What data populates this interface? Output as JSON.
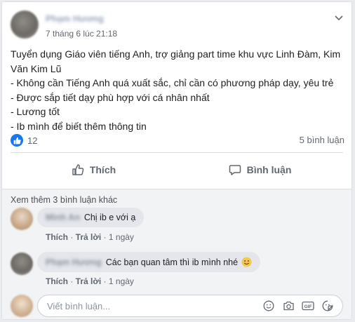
{
  "post": {
    "author": "Phạm Hương",
    "time": "7 tháng 6 lúc 21:18",
    "lines": [
      "Tuyển dụng Giáo viên tiếng Anh, trợ giảng part time khu vực Linh Đàm, Kim Văn Kim Lũ",
      "- Không cần Tiếng Anh quá xuất sắc, chỉ cần có phương pháp dạy, yêu trẻ",
      "- Được sắp tiết dạy phù hợp với cá nhân nhất",
      "- Lương tốt",
      "- Ib mình để biết thêm thông tin"
    ],
    "like_count": "12",
    "comment_count": "5 bình luận"
  },
  "actions": {
    "like": "Thích",
    "comment": "Bình luận"
  },
  "comments": {
    "more_label": "Xem thêm 3 bình luận khác",
    "items": [
      {
        "author": "Minh An",
        "text": "Chị ib e với ạ",
        "like": "Thích",
        "reply": "Trả lời",
        "time": "1 ngày"
      },
      {
        "author": "Phạm Hương",
        "text": "Các bạn quan tâm thì ib mình nhé",
        "like": "Thích",
        "reply": "Trả lời",
        "time": "1 ngày"
      }
    ],
    "composer_placeholder": "Viết bình luận..."
  },
  "icons": {
    "like": "like-icon",
    "comment": "comment-icon",
    "emoji": "smile-emoji-icon",
    "camera": "camera-icon",
    "gif": "gif-icon",
    "sticker": "sticker-icon",
    "chevron": "chevron-down-icon"
  },
  "colors": {
    "brand": "#1877f2",
    "muted": "#606770",
    "bubble": "#e4e6eb"
  }
}
